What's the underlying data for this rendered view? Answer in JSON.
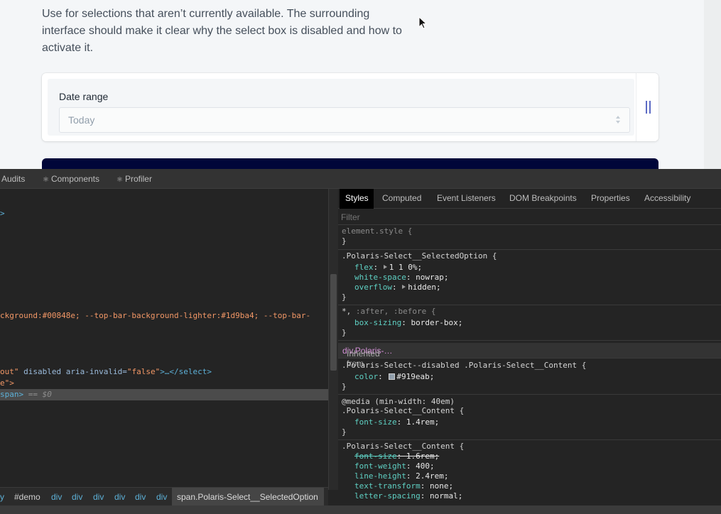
{
  "page": {
    "description": "Use for selections that aren’t currently available. The surrounding interface should make it clear why the select box is disabled and how to activate it.",
    "select_label": "Date range",
    "select_value": "Today"
  },
  "devtools": {
    "tabs": [
      "Audits",
      "Components",
      "Profiler"
    ],
    "code_lines": {
      "line1": ">",
      "line2_val": "ckground:#00848e; --top-bar-background-lighter:#1d9ba4; --top-bar-",
      "line3_val": "out\"",
      "line3_attr": " disabled aria-invalid=",
      "line3_val2": "\"false\"",
      "line3_tag": ">…</select>",
      "line4": "e\">",
      "line5_tag": "span>",
      "line5_dim": " == $0"
    },
    "breadcrumbs": [
      "y",
      "#demo",
      "div",
      "div",
      "div",
      "div",
      "div",
      "div",
      "span.Polaris-Select__SelectedOption"
    ],
    "styles_tabs": [
      "Styles",
      "Computed",
      "Event Listeners",
      "DOM Breakpoints",
      "Properties",
      "Accessibility"
    ],
    "filter_placeholder": "Filter",
    "rules": {
      "element_style": "element.style {",
      "close": "}",
      "r1_selector": ".Polaris-Select__SelectedOption {",
      "r1_p1_name": "flex",
      "r1_p1_val": "1 1 0%;",
      "r1_p2_name": "white-space",
      "r1_p2_val": "nowrap;",
      "r1_p3_name": "overflow",
      "r1_p3_val": "hidden;",
      "r2_selector_a": "*,",
      "r2_selector_b": " :after, :before {",
      "r2_p1_name": "box-sizing",
      "r2_p1_val": "border-box;",
      "inherited_prefix": "Inherited from ",
      "inherited_target": "div.Polaris-…",
      "r3_selector": ".Polaris-Select--disabled .Polaris-Select__Content {",
      "r3_p1_name": "color",
      "r3_p1_val": "#919eab;",
      "r4_media": "@media (min-width: 40em)",
      "r4_selector": ".Polaris-Select__Content {",
      "r4_p1_name": "font-size",
      "r4_p1_val": "1.4rem;",
      "r5_selector": ".Polaris-Select__Content {",
      "r5_p1_name": "font-size",
      "r5_p1_val": "1.6rem;",
      "r5_p2_name": "font-weight",
      "r5_p2_val": "400;",
      "r5_p3_name": "line-height",
      "r5_p3_val": "2.4rem;",
      "r5_p4_name": "text-transform",
      "r5_p4_val": "none;",
      "r5_p5_name": "letter-spacing",
      "r5_p5_val": "normal;"
    }
  },
  "colors": {
    "disabled_text": "#919eab",
    "accent": "#5c6ac4",
    "banner": "#000639"
  },
  "icons": [
    "cursor-arrow-icon",
    "select-arrows-icon",
    "resize-handle-icon",
    "react-atom-icon",
    "expand-triangle-icon",
    "color-swatch-icon"
  ]
}
